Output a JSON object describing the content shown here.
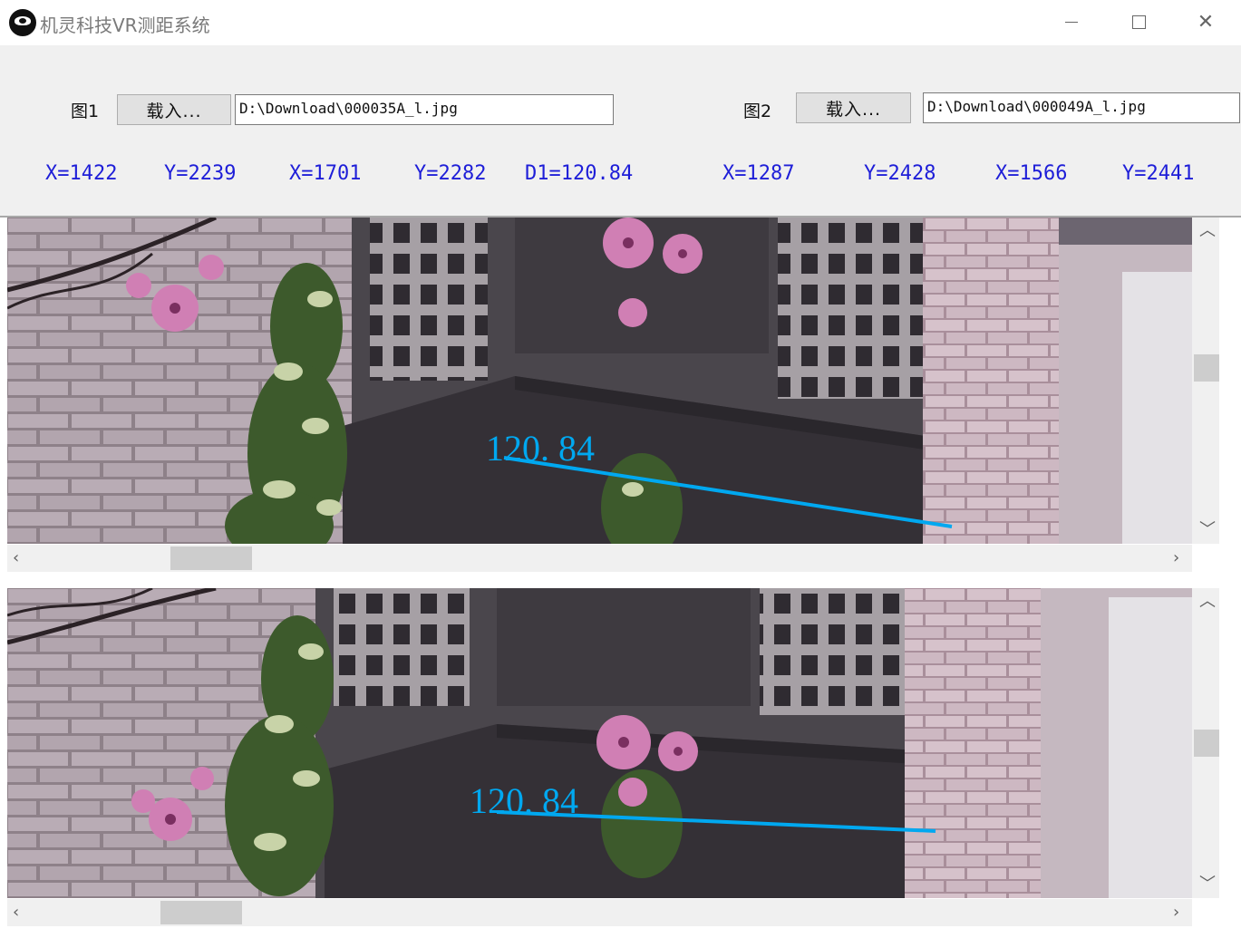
{
  "window": {
    "title": "机灵科技VR测距系统"
  },
  "controls": {
    "image1": {
      "label": "图1",
      "load_button": "载入...",
      "path": "D:\\Download\\000035A_l.jpg"
    },
    "image2": {
      "label": "图2",
      "load_button": "载入...",
      "path": "D:\\Download\\000049A_l.jpg"
    }
  },
  "readouts": [
    "X=1422",
    "Y=2239",
    "X=1701",
    "Y=2282",
    "D1=120.84",
    "X=1287",
    "Y=2428",
    "X=1566",
    "Y=2441"
  ],
  "views": [
    {
      "measurement_label": "120. 84",
      "line_color": "#00a8f0"
    },
    {
      "measurement_label": "120. 84",
      "line_color": "#00a8f0"
    }
  ],
  "scroll": {
    "view1": {
      "horizontal_position": 0.13,
      "vertical_position": 0.45
    },
    "view2": {
      "horizontal_position": 0.12,
      "vertical_position": 0.5
    }
  }
}
